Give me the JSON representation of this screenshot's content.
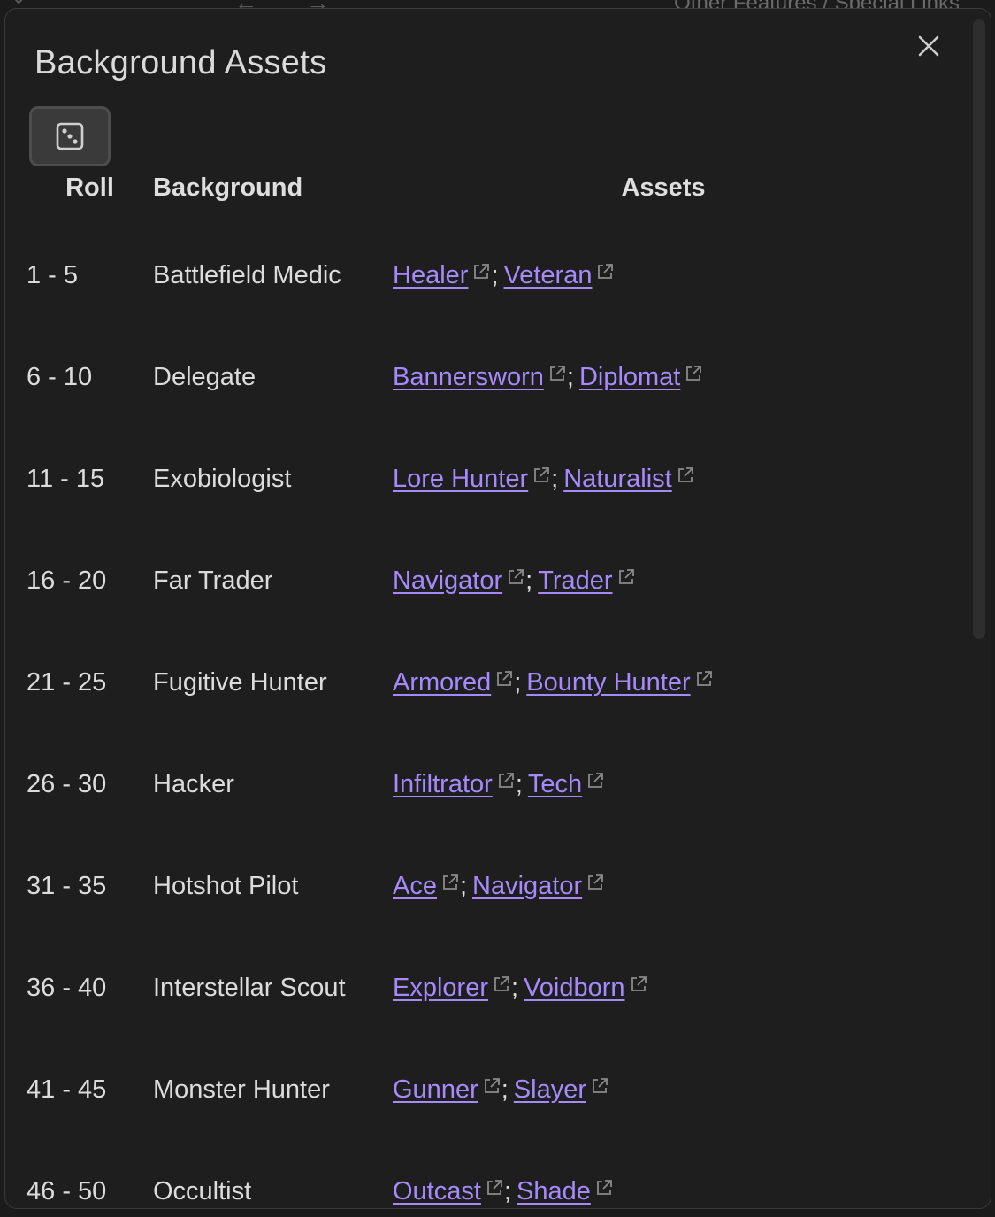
{
  "background_chrome": {
    "breadcrumb": "Other Features / Special Links",
    "arrows": "← →",
    "chevron": "⌄"
  },
  "modal": {
    "title": "Background Assets",
    "close_icon": "close-icon",
    "roll_icon": "dice-icon"
  },
  "table": {
    "headers": {
      "roll": "Roll",
      "background": "Background",
      "assets": "Assets"
    },
    "rows": [
      {
        "roll": "1 - 5",
        "background": "Battlefield Medic",
        "asset1": "Healer",
        "asset2": "Veteran"
      },
      {
        "roll": "6 - 10",
        "background": "Delegate",
        "asset1": "Bannersworn",
        "asset2": "Diplomat"
      },
      {
        "roll": "11 - 15",
        "background": "Exobiologist",
        "asset1": "Lore Hunter",
        "asset2": "Naturalist"
      },
      {
        "roll": "16 - 20",
        "background": "Far Trader",
        "asset1": "Navigator",
        "asset2": "Trader"
      },
      {
        "roll": "21 - 25",
        "background": "Fugitive Hunter",
        "asset1": "Armored",
        "asset2": "Bounty Hunter"
      },
      {
        "roll": "26 - 30",
        "background": "Hacker",
        "asset1": "Infiltrator",
        "asset2": "Tech"
      },
      {
        "roll": "31 - 35",
        "background": "Hotshot Pilot",
        "asset1": "Ace",
        "asset2": "Navigator"
      },
      {
        "roll": "36 - 40",
        "background": "Interstellar Scout",
        "asset1": "Explorer",
        "asset2": "Voidborn"
      },
      {
        "roll": "41 - 45",
        "background": "Monster Hunter",
        "asset1": "Gunner",
        "asset2": "Slayer"
      },
      {
        "roll": "46 - 50",
        "background": "Occultist",
        "asset1": "Outcast",
        "asset2": "Shade"
      }
    ],
    "separator": ";"
  },
  "colors": {
    "link": "#a68afc",
    "text": "#dcdcdc",
    "modal_bg": "#1e1e1e"
  }
}
